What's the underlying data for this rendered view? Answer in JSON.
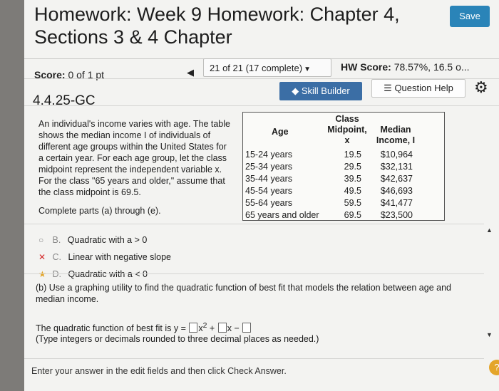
{
  "header": {
    "title_line1": "Homework: Week 9 Homework: Chapter 4,",
    "title_line2": "Sections 3 & 4 Chapter",
    "save_label": "Save"
  },
  "status": {
    "score_label": "Score:",
    "score_value": "0 of 1 pt",
    "question_nav": "21 of 21 (17 complete)",
    "hw_score_label": "HW Score:",
    "hw_score_value": "78.57%, 16.5 o..."
  },
  "question": {
    "number": "4.4.25-GC",
    "skill_builder_label": "Skill Builder",
    "question_help_label": "Question Help",
    "text": "An individual's income varies with age. The table shows the median income I of individuals of different age groups within the United States for a certain year. For each age group, let the class midpoint represent the independent variable x. For the class \"65 years and older,\" assume that the class midpoint is 69.5.",
    "parts_text": "Complete parts (a) through (e)."
  },
  "table": {
    "headers": {
      "age": "Age",
      "mid1": "Class",
      "mid2": "Midpoint,",
      "mid3": "x",
      "inc1": "Median",
      "inc2": "Income, I"
    },
    "rows": [
      {
        "age": "15-24 years",
        "mid": "19.5",
        "income": "$10,964"
      },
      {
        "age": "25-34 years",
        "mid": "29.5",
        "income": "$32,131"
      },
      {
        "age": "35-44 years",
        "mid": "39.5",
        "income": "$42,637"
      },
      {
        "age": "45-54 years",
        "mid": "49.5",
        "income": "$46,693"
      },
      {
        "age": "55-64 years",
        "mid": "59.5",
        "income": "$41,477"
      },
      {
        "age": "65 years and older",
        "mid": "69.5",
        "income": "$23,500"
      }
    ]
  },
  "options": [
    {
      "letter": "B.",
      "text": "Quadratic with a > 0",
      "mark": "○"
    },
    {
      "letter": "C.",
      "text": "Linear with negative slope",
      "mark": "✕"
    },
    {
      "letter": "D.",
      "text": "Quadratic with a < 0",
      "mark": "★"
    }
  ],
  "part_b": {
    "text": "(b) Use a graphing utility to find the quadratic function of best fit that models the relation between age and median income.",
    "answer_prefix": "The quadratic function of best fit is y =",
    "x2": "x",
    "sup": "2",
    "plus": "+",
    "x": "x",
    "minus": "−",
    "hint": "(Type integers or decimals rounded to three decimal places as needed.)"
  },
  "footer": {
    "text": "Enter your answer in the edit fields and then click Check Answer."
  },
  "colors": {
    "save": "#2a84b8",
    "skill": "#3b6ea5",
    "help_circle": "#e4a52a"
  }
}
